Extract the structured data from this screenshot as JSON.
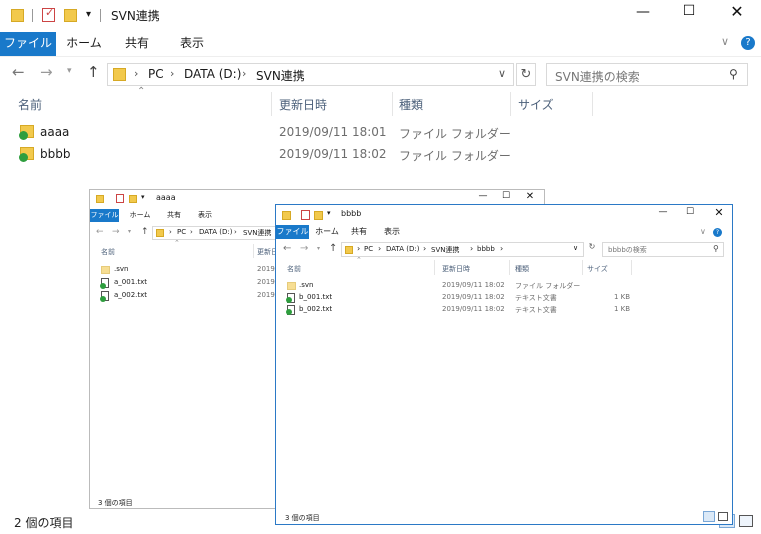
{
  "main": {
    "title": "SVN連携",
    "ribbon_tabs": [
      "ファイル",
      "ホーム",
      "共有",
      "表示"
    ],
    "address": [
      "PC",
      "DATA (D:)",
      "SVN連携"
    ],
    "search_placeholder": "SVN連携の検索",
    "columns": [
      "名前",
      "更新日時",
      "種類",
      "サイズ"
    ],
    "rows": [
      {
        "name": "aaaa",
        "date": "2019/09/11 18:01",
        "type": "ファイル フォルダー",
        "size": ""
      },
      {
        "name": "bbbb",
        "date": "2019/09/11 18:02",
        "type": "ファイル フォルダー",
        "size": ""
      }
    ],
    "status": "2 個の項目"
  },
  "win_a": {
    "title": "aaaa",
    "ribbon_tabs": [
      "ファイル",
      "ホーム",
      "共有",
      "表示"
    ],
    "address": [
      "PC",
      "DATA (D:)",
      "SVN連携"
    ],
    "columns": [
      "名前",
      "更新日"
    ],
    "rows": [
      {
        "name": ".svn",
        "date": "2019/0"
      },
      {
        "name": "a_001.txt",
        "date": "2019/0"
      },
      {
        "name": "a_002.txt",
        "date": "2019/0"
      }
    ],
    "status": "3 個の項目"
  },
  "win_b": {
    "title": "bbbb",
    "ribbon_tabs": [
      "ファイル",
      "ホーム",
      "共有",
      "表示"
    ],
    "address": [
      "PC",
      "DATA (D:)",
      "SVN連携",
      "bbbb"
    ],
    "search_placeholder": "bbbbの検索",
    "columns": [
      "名前",
      "更新日時",
      "種類",
      "サイズ"
    ],
    "rows": [
      {
        "name": ".svn",
        "date": "2019/09/11 18:02",
        "type": "ファイル フォルダー",
        "size": ""
      },
      {
        "name": "b_001.txt",
        "date": "2019/09/11 18:02",
        "type": "テキスト文書",
        "size": "1 KB"
      },
      {
        "name": "b_002.txt",
        "date": "2019/09/11 18:02",
        "type": "テキスト文書",
        "size": "1 KB"
      }
    ],
    "status": "3 個の項目"
  },
  "colors": {
    "accent": "#1979ca",
    "folder": "#f2c94c",
    "svn_ok": "#2e9e3e"
  }
}
